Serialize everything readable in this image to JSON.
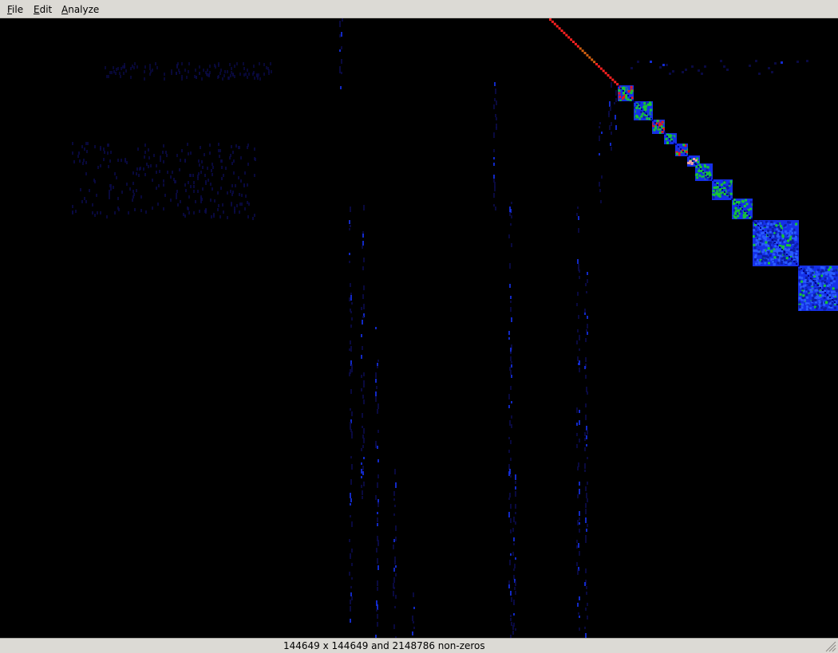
{
  "menubar": {
    "items": [
      {
        "mnemonic": "F",
        "rest": "ile"
      },
      {
        "mnemonic": "E",
        "rest": "dit"
      },
      {
        "mnemonic": "A",
        "rest": "nalyze"
      }
    ]
  },
  "matrix_view": {
    "colors": {
      "background": "#000000",
      "faint": "#0a0a4a",
      "low": "#1530e8",
      "mid": "#18c830",
      "high": "#e81818",
      "diagonal": "#ff2020",
      "diagonal_mid": "#d06010"
    }
  },
  "status": {
    "text": "144649 x 144649 and 2148786 non-zeros"
  }
}
